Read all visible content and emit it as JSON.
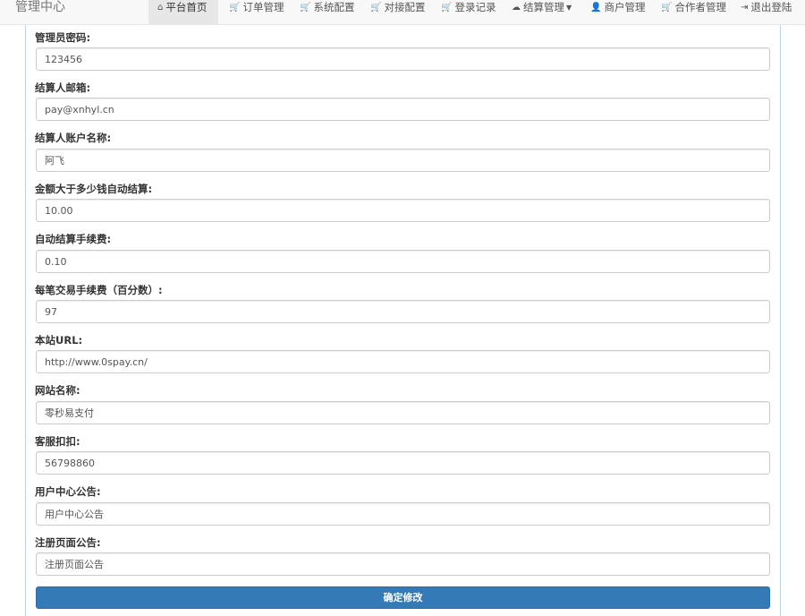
{
  "navbar": {
    "brand": "管理中心",
    "items": [
      {
        "label": "平台首页",
        "icon": "home-icon",
        "glyph": "⌂"
      },
      {
        "label": "订单管理",
        "icon": "cart-icon",
        "glyph": "🛒"
      },
      {
        "label": "系统配置",
        "icon": "cart-icon",
        "glyph": "🛒"
      },
      {
        "label": "对接配置",
        "icon": "cart-icon",
        "glyph": "🛒"
      },
      {
        "label": "登录记录",
        "icon": "cart-icon",
        "glyph": "🛒"
      },
      {
        "label": "结算管理",
        "icon": "cloud-icon",
        "glyph": "☁"
      },
      {
        "label": "商户管理",
        "icon": "user-icon",
        "glyph": "👤"
      },
      {
        "label": "合作者管理",
        "icon": "cart-icon",
        "glyph": "🛒"
      },
      {
        "label": "退出登陆",
        "icon": "logout-icon",
        "glyph": "⇥"
      }
    ]
  },
  "form": {
    "fields": [
      {
        "label": "管理员密码:",
        "value": "123456"
      },
      {
        "label": "结算人邮箱:",
        "value": "pay@xnhyl.cn"
      },
      {
        "label": "结算人账户名称:",
        "value": "阿飞"
      },
      {
        "label": "金额大于多少钱自动结算:",
        "value": "10.00"
      },
      {
        "label": "自动结算手续费:",
        "value": "0.10"
      },
      {
        "label": "每笔交易手续费（百分数）:",
        "value": "97"
      },
      {
        "label": "本站URL:",
        "value": "http://www.0spay.cn/"
      },
      {
        "label": "网站名称:",
        "value": "零秒易支付"
      },
      {
        "label": "客服扣扣:",
        "value": "56798860"
      },
      {
        "label": "用户中心公告:",
        "value": "用户中心公告"
      },
      {
        "label": "注册页面公告:",
        "value": "注册页面公告"
      }
    ],
    "submit_label": "确定修改"
  },
  "colors": {
    "primary": "#337ab7",
    "navbar_bg": "#f8f8f8",
    "active_tab_bg": "#e7e7e7"
  }
}
